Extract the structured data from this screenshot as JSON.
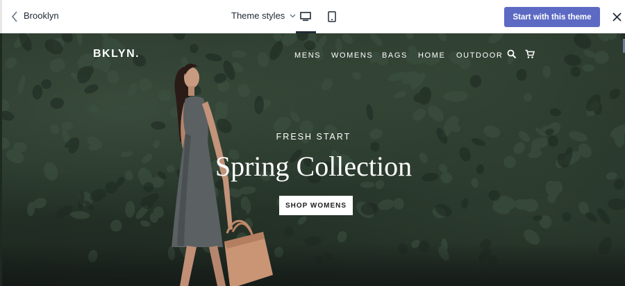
{
  "editor": {
    "theme_name": "Brooklyn",
    "theme_styles_label": "Theme styles",
    "start_button_label": "Start with this theme",
    "accent_color": "#5c6ac4",
    "icons": [
      "back-chevron-icon",
      "chevron-down-icon",
      "desktop-icon",
      "mobile-icon",
      "close-icon"
    ]
  },
  "store": {
    "logo": "BKLYN.",
    "nav": [
      "MENS",
      "WOMENS",
      "BAGS",
      "HOME",
      "OUTDOOR"
    ],
    "icons": [
      "search-icon",
      "cart-icon"
    ]
  },
  "hero": {
    "kicker": "FRESH START",
    "headline": "Spring Collection",
    "button_label": "SHOP WOMENS"
  }
}
